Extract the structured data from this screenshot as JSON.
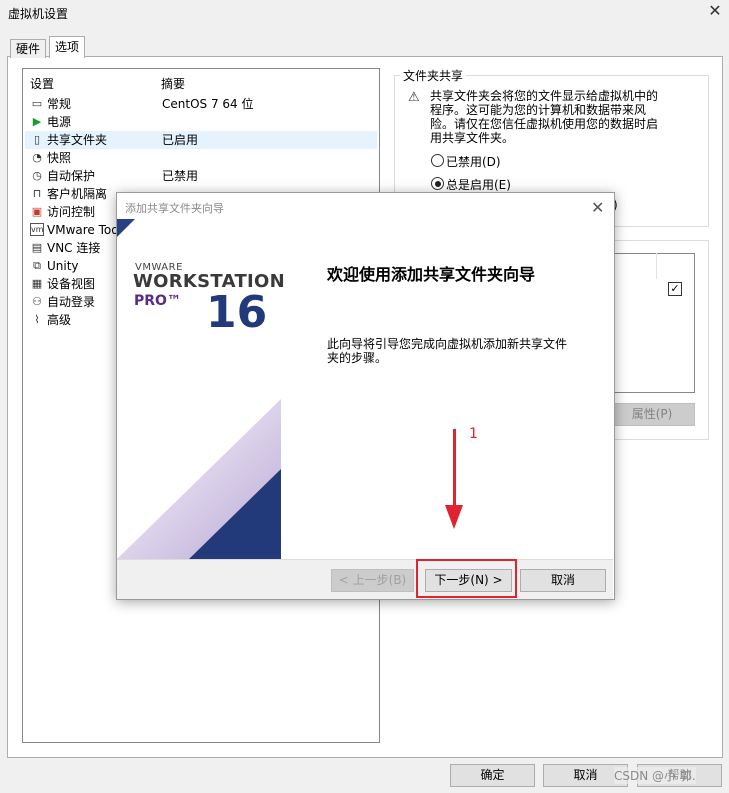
{
  "window": {
    "title": "虚拟机设置"
  },
  "tabs": [
    {
      "label": "硬件"
    },
    {
      "label": "选项"
    }
  ],
  "settings": {
    "header_setting": "设置",
    "header_summary": "摘要",
    "items": [
      {
        "icon": "monitor-icon",
        "label": "常规",
        "summary": "CentOS 7 64 位"
      },
      {
        "icon": "play-icon",
        "label": "电源",
        "summary": ""
      },
      {
        "icon": "shared-folder-icon",
        "label": "共享文件夹",
        "summary": "已启用"
      },
      {
        "icon": "snapshot-icon",
        "label": "快照",
        "summary": ""
      },
      {
        "icon": "clock-icon",
        "label": "自动保护",
        "summary": "已禁用"
      },
      {
        "icon": "lock-icon",
        "label": "客户机隔离",
        "summary": ""
      },
      {
        "icon": "access-control-icon",
        "label": "访问控制",
        "summary": ""
      },
      {
        "icon": "vmware-tools-icon",
        "label": "VMware Too",
        "summary": ""
      },
      {
        "icon": "vnc-icon",
        "label": "VNC 连接",
        "summary": ""
      },
      {
        "icon": "unity-icon",
        "label": "Unity",
        "summary": ""
      },
      {
        "icon": "device-view-icon",
        "label": "设备视图",
        "summary": ""
      },
      {
        "icon": "autologin-icon",
        "label": "自动登录",
        "summary": ""
      },
      {
        "icon": "advanced-icon",
        "label": "高级",
        "summary": ""
      }
    ]
  },
  "shared_folders": {
    "group_title": "文件夹共享",
    "warning": "共享文件夹会将您的文件显示给虚拟机中的程序。这可能为您的计算机和数据带来风险。请仅在您信任虚拟机使用您的数据时启用共享文件夹。",
    "radio_disabled": "已禁用(D)",
    "radio_always": "总是启用(E)",
    "radio_partial_tail": ")",
    "properties_button": "属性(P)"
  },
  "wizard": {
    "title": "添加共享文件夹向导",
    "brand_vmware": "VMWARE",
    "brand_workstation": "WORKSTATION",
    "brand_pro": "PRO™",
    "brand_version": "16",
    "heading": "欢迎使用添加共享文件夹向导",
    "description": "此向导将引导您完成向虚拟机添加新共享文件夹的步骤。",
    "back_button": "< 上一步(B)",
    "next_button": "下一步(N) >",
    "cancel_button": "取消"
  },
  "annotation": {
    "number": "1",
    "color": "#e0232e"
  },
  "footer": {
    "ok_button": "确定",
    "cancel_button": "取消",
    "help_button": "帮助",
    "watermark": "CSDN @小 郭."
  }
}
